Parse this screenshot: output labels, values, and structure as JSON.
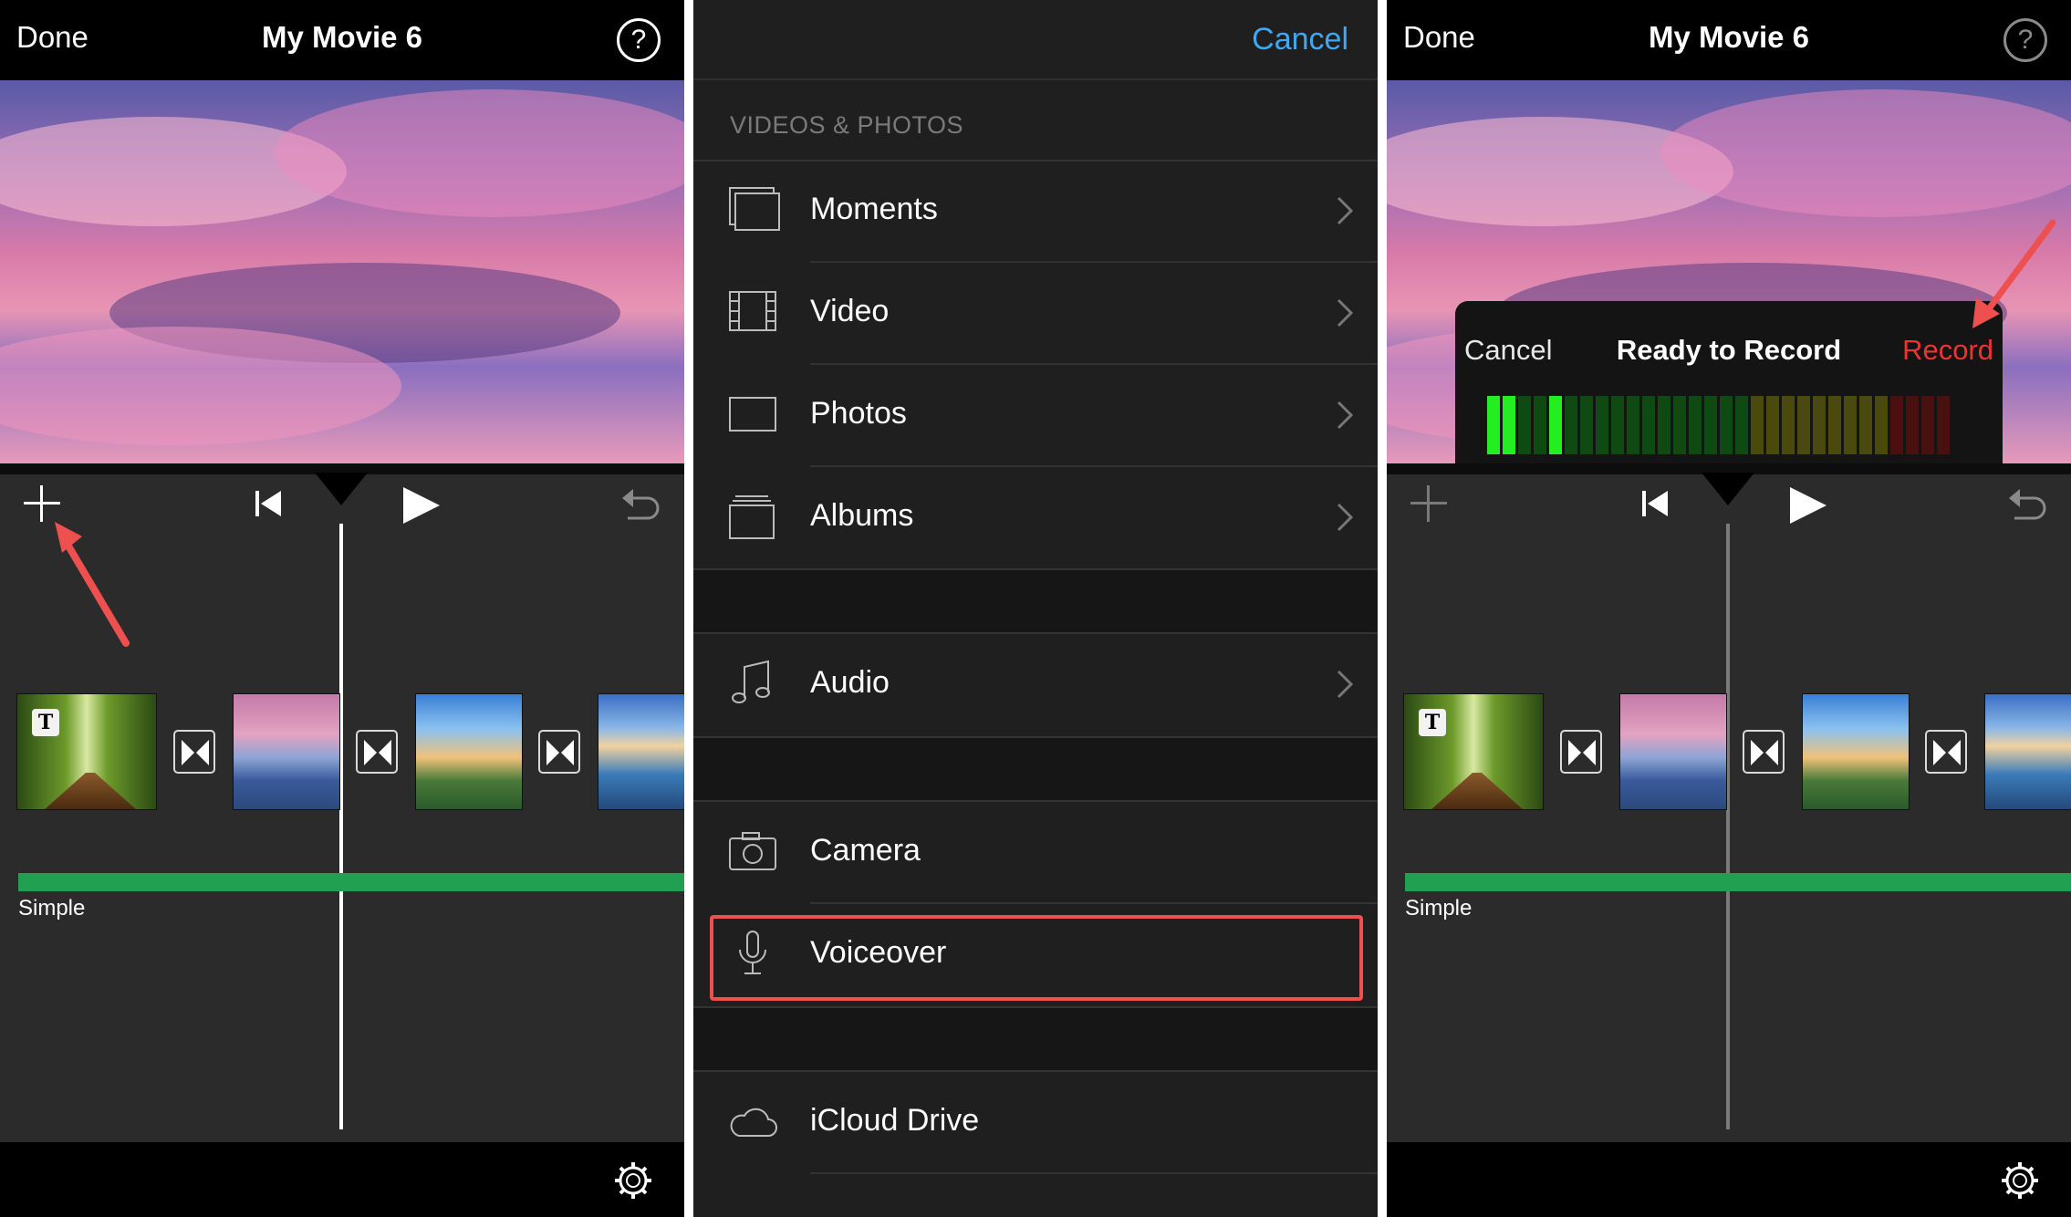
{
  "editor": {
    "done_label": "Done",
    "title": "My Movie 6",
    "help_label": "?",
    "track_label": "Simple",
    "clip_title_badge": "T"
  },
  "browser": {
    "cancel_label": "Cancel",
    "section_header": "VIDEOS & PHOTOS",
    "items": [
      {
        "label": "Moments",
        "icon": "moments-icon"
      },
      {
        "label": "Video",
        "icon": "film-icon"
      },
      {
        "label": "Photos",
        "icon": "photo-icon"
      },
      {
        "label": "Albums",
        "icon": "albums-icon"
      },
      {
        "label": "Audio",
        "icon": "music-note-icon"
      },
      {
        "label": "Camera",
        "icon": "camera-icon"
      },
      {
        "label": "Voiceover",
        "icon": "microphone-icon"
      },
      {
        "label": "iCloud Drive",
        "icon": "cloud-icon"
      }
    ]
  },
  "record_popup": {
    "cancel_label": "Cancel",
    "title": "Ready to Record",
    "record_label": "Record"
  },
  "colors": {
    "accent_blue": "#3ea8f5",
    "record_red": "#ee3333",
    "highlight_red": "#ee4f4f",
    "audio_track_green": "#20a050"
  }
}
